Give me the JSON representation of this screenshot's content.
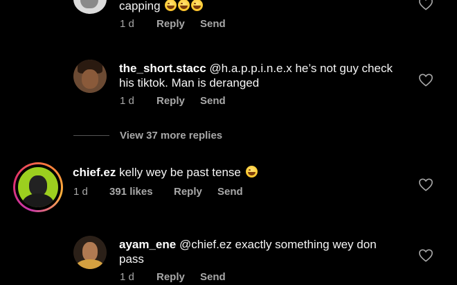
{
  "comments": [
    {
      "username": "",
      "text": "capping",
      "emoji_count": 3,
      "time": "1 d",
      "reply_label": "Reply",
      "send_label": "Send"
    },
    {
      "username": "the_short.stacc",
      "text_line1": "@h.a.p.p.i.n.e.x he’s not guy check",
      "text_line2": "his tiktok. Man is deranged",
      "time": "1 d",
      "reply_label": "Reply",
      "send_label": "Send"
    },
    {
      "username": "chief.ez",
      "text": "kelly wey be past tense",
      "time": "1 d",
      "likes": "391 likes",
      "reply_label": "Reply",
      "send_label": "Send"
    },
    {
      "username": "ayam_ene",
      "text_line1": "@chief.ez exactly something wey don",
      "text_line2": "pass",
      "time": "1 d",
      "reply_label": "Reply",
      "send_label": "Send"
    }
  ],
  "view_replies": "View 37 more replies",
  "icons": {
    "like": "heart-outline-icon",
    "emoji": "grinning-squinting-face-emoji"
  },
  "colors": {
    "background": "#000000",
    "text": "#f5f5f5",
    "muted": "#a8a8a8",
    "story_ring_start": "#c837ab",
    "story_ring_end": "#ff9a3c"
  }
}
